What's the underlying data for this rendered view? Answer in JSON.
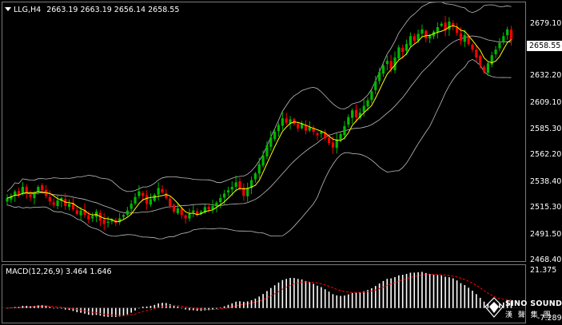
{
  "header": {
    "symbol": "LLG,H4",
    "ohlc": "2663.19 2663.19 2656.14 2658.55"
  },
  "price_axis": {
    "ticks": [
      "2679.10",
      "2632.20",
      "2609.10",
      "2585.30",
      "2562.20",
      "2538.40",
      "2515.30",
      "2491.50",
      "2468.40"
    ],
    "hidden_tick": "2656.00",
    "current_price": "2658.55"
  },
  "macd": {
    "title": "MACD(12,26,9) 3.464 1.646",
    "axis_top": "21.375",
    "axis_bottom": "-7.289"
  },
  "logo": {
    "name": "SINO SOUND",
    "sub": "漢 聲 集 團"
  },
  "colors": {
    "background": "#000000",
    "bull": "#00b800",
    "bear": "#ff0000",
    "ma_fast": "#ffff00",
    "bands": "#bdbdbd",
    "macd_hist": "#ffffff",
    "macd_signal": "#ff0000"
  },
  "chart_data": {
    "type": "candlestick",
    "instrument": "LLG",
    "timeframe": "H4",
    "ylim": [
      2462,
      2692
    ],
    "closes": [
      2518,
      2520,
      2524,
      2521,
      2528,
      2522,
      2519,
      2523,
      2528,
      2525,
      2520,
      2515,
      2512,
      2516,
      2518,
      2511,
      2513,
      2508,
      2504,
      2507,
      2503,
      2499,
      2502,
      2506,
      2498,
      2495,
      2497,
      2499,
      2496,
      2500,
      2503,
      2507,
      2513,
      2519,
      2524,
      2520,
      2513,
      2517,
      2521,
      2527,
      2523,
      2518,
      2511,
      2506,
      2509,
      2503,
      2500,
      2504,
      2507,
      2503,
      2506,
      2510,
      2508,
      2511,
      2514,
      2518,
      2522,
      2525,
      2528,
      2532,
      2526,
      2520,
      2527,
      2534,
      2540,
      2548,
      2556,
      2565,
      2572,
      2577,
      2583,
      2589,
      2585,
      2588,
      2584,
      2580,
      2584,
      2578,
      2581,
      2577,
      2574,
      2577,
      2571,
      2567,
      2563,
      2570,
      2575,
      2582,
      2590,
      2596,
      2590,
      2594,
      2600,
      2605,
      2613,
      2622,
      2630,
      2636,
      2640,
      2633,
      2643,
      2652,
      2648,
      2655,
      2662,
      2658,
      2664,
      2668,
      2660,
      2663,
      2666,
      2670,
      2673,
      2667,
      2675,
      2671,
      2665,
      2658,
      2663,
      2655,
      2650,
      2643,
      2636,
      2630,
      2638,
      2645,
      2650,
      2656,
      2662,
      2668,
      2659
    ],
    "macd": {
      "value": 3.464,
      "signal": 1.646,
      "ylim": [
        -7.289,
        21.375
      ]
    }
  }
}
